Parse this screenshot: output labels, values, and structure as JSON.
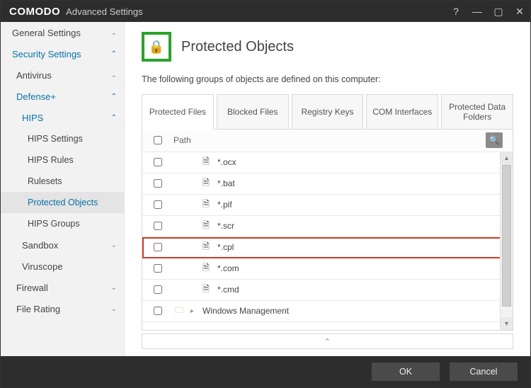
{
  "window": {
    "brand": "COMODO",
    "subtitle": "Advanced Settings"
  },
  "sidebar": {
    "general": "General Settings",
    "security": "Security Settings",
    "antivirus": "Antivirus",
    "defense": "Defense+",
    "hips": "HIPS",
    "hips_settings": "HIPS Settings",
    "hips_rules": "HIPS Rules",
    "rulesets": "Rulesets",
    "protected_objects": "Protected Objects",
    "hips_groups": "HIPS Groups",
    "sandbox": "Sandbox",
    "viruscope": "Viruscope",
    "firewall": "Firewall",
    "file_rating": "File Rating"
  },
  "page": {
    "title": "Protected Objects",
    "intro": "The following groups of objects are defined on this computer:",
    "tabs": {
      "protected_files": "Protected Files",
      "blocked_files": "Blocked Files",
      "registry_keys": "Registry Keys",
      "com_interfaces": "COM Interfaces",
      "protected_data_folders": "Protected Data Folders"
    },
    "table_header": "Path",
    "rows": [
      {
        "name": "*.ocx"
      },
      {
        "name": "*.bat"
      },
      {
        "name": "*.pif"
      },
      {
        "name": "*.scr"
      },
      {
        "name": "*.cpl"
      },
      {
        "name": "*.com"
      },
      {
        "name": "*.cmd"
      }
    ],
    "group_row": "Windows Management",
    "highlight_index": 4
  },
  "footer": {
    "ok": "OK",
    "cancel": "Cancel"
  }
}
